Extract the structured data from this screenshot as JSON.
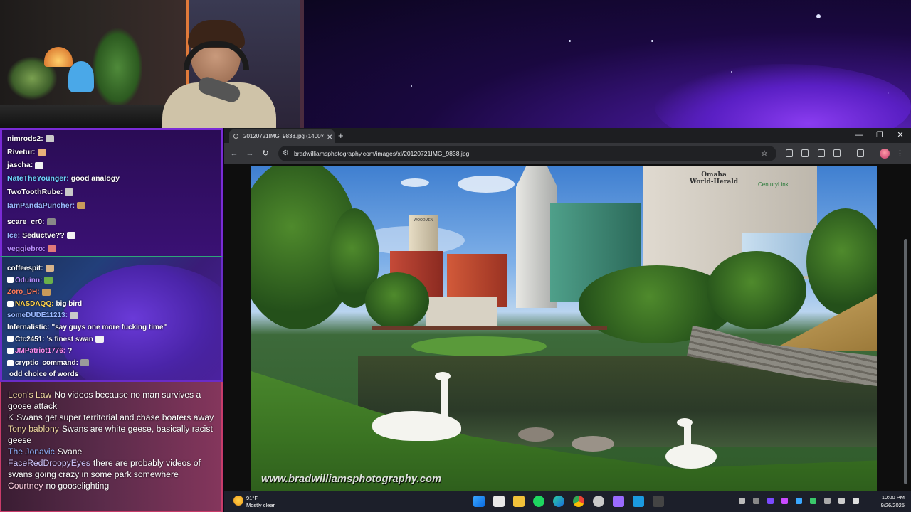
{
  "colors": {
    "accent_purple": "#7a2bd6",
    "chat_pink_border": "#c83c6a",
    "browser_dark": "#202124",
    "taskbar": "#1c1f2a"
  },
  "chat_upper": [
    {
      "user": "nimrods2:",
      "msg": "",
      "color": "#ffffff",
      "emote": "#c9c9c9"
    },
    {
      "user": "Rivetur:",
      "msg": "",
      "color": "#ffffff",
      "emote": "#e8b07a"
    },
    {
      "user": "jascha:",
      "msg": "",
      "color": "#ffffff",
      "emote": "#f2f2f2"
    },
    {
      "user": "NateTheYounger:",
      "msg": "good analogy",
      "color": "#6fd6ff",
      "emote": ""
    },
    {
      "user": "TwoToothRube:",
      "msg": "",
      "color": "#ffffff",
      "emote": "#c9c9c9"
    },
    {
      "user": "IamPandaPuncher:",
      "msg": "",
      "color": "#9ab8ff",
      "emote": "#c89a5a"
    },
    {
      "user": "scare_cr0:",
      "msg": "",
      "color": "#ffffff",
      "emote": "#888888"
    },
    {
      "user": "Ice:",
      "msg": "Seductve??",
      "color": "#9ab8ff",
      "emote": "#f2f2f2"
    },
    {
      "user": "veggiebro:",
      "msg": "",
      "color": "#b98cff",
      "emote": "#e07a7a"
    }
  ],
  "chat_mid": [
    {
      "user": "coffeespit:",
      "msg": "",
      "color": "#ffffff",
      "emote": "#d8b48a",
      "badge": false
    },
    {
      "user": "Oduinn:",
      "msg": "",
      "color": "#b98cff",
      "emote": "#6ab04a",
      "badge": true
    },
    {
      "user": "Zoro_DH:",
      "msg": "",
      "color": "#ff7a5a",
      "emote": "#c89a5a",
      "badge": false
    },
    {
      "user": "NASDAQQ:",
      "msg": "big bird",
      "color": "#ffd24a",
      "emote": "",
      "badge": true
    },
    {
      "user": "someDUDE11213:",
      "msg": "",
      "color": "#9ab8ff",
      "emote": "#c9c9c9",
      "badge": false
    },
    {
      "user": "Infernalistic:",
      "msg": "\"say guys one more fucking time\"",
      "color": "#ffffff",
      "emote": "",
      "badge": false
    },
    {
      "user": "Ctc2451:",
      "msg": "'s finest swan",
      "color": "#ffffff",
      "emote": "#f2f2f2",
      "badge": true
    },
    {
      "user": "JMPatriot1776:",
      "msg": "?",
      "color": "#ff8cf0",
      "emote": "",
      "badge": true
    },
    {
      "user": "cryptic_command:",
      "msg": "",
      "color": "#ffffff",
      "emote": "#9a9a9a",
      "badge": true
    },
    {
      "user": "",
      "msg": "odd choice of words",
      "color": "#ff4a4a",
      "emote": "",
      "badge": false
    }
  ],
  "chat_lower": [
    {
      "user": "Leon's Law",
      "msg": "No videos because no man survives a goose attack",
      "color": "#f0d8a0"
    },
    {
      "user": "K",
      "msg": "Swans get super territorial and chase boaters away",
      "color": "#ffffff"
    },
    {
      "user": "Tony bablony",
      "msg": "Swans are white geese, basically racist geese",
      "color": "#f0d8a0"
    },
    {
      "user": "The Jonavic",
      "msg": "Svane",
      "color": "#8fb4ff"
    },
    {
      "user": "FaceRedDroopyEyes",
      "msg": "there are probably videos of swans going crazy in some park somewhere",
      "color": "#d0c8ff"
    },
    {
      "user": "Courtney",
      "msg": "no gooselighting",
      "color": "#ffd0e0"
    }
  ],
  "browser": {
    "tab_title": "20120721IMG_9838.jpg (1400×",
    "url": "bradwilliamsphotography.com/images/xl/20120721IMG_9838.jpg",
    "watermark": "www.bradwilliamsphotography.com",
    "sign_building": "Omaha\nWorld-Herald",
    "sign_centurylink": "CenturyLink",
    "sign_woodmen": "WOODMEN"
  },
  "taskbar": {
    "temp": "91°F",
    "weather": "Mostly clear",
    "time": "10:00 PM",
    "date": "9/26/2025"
  }
}
